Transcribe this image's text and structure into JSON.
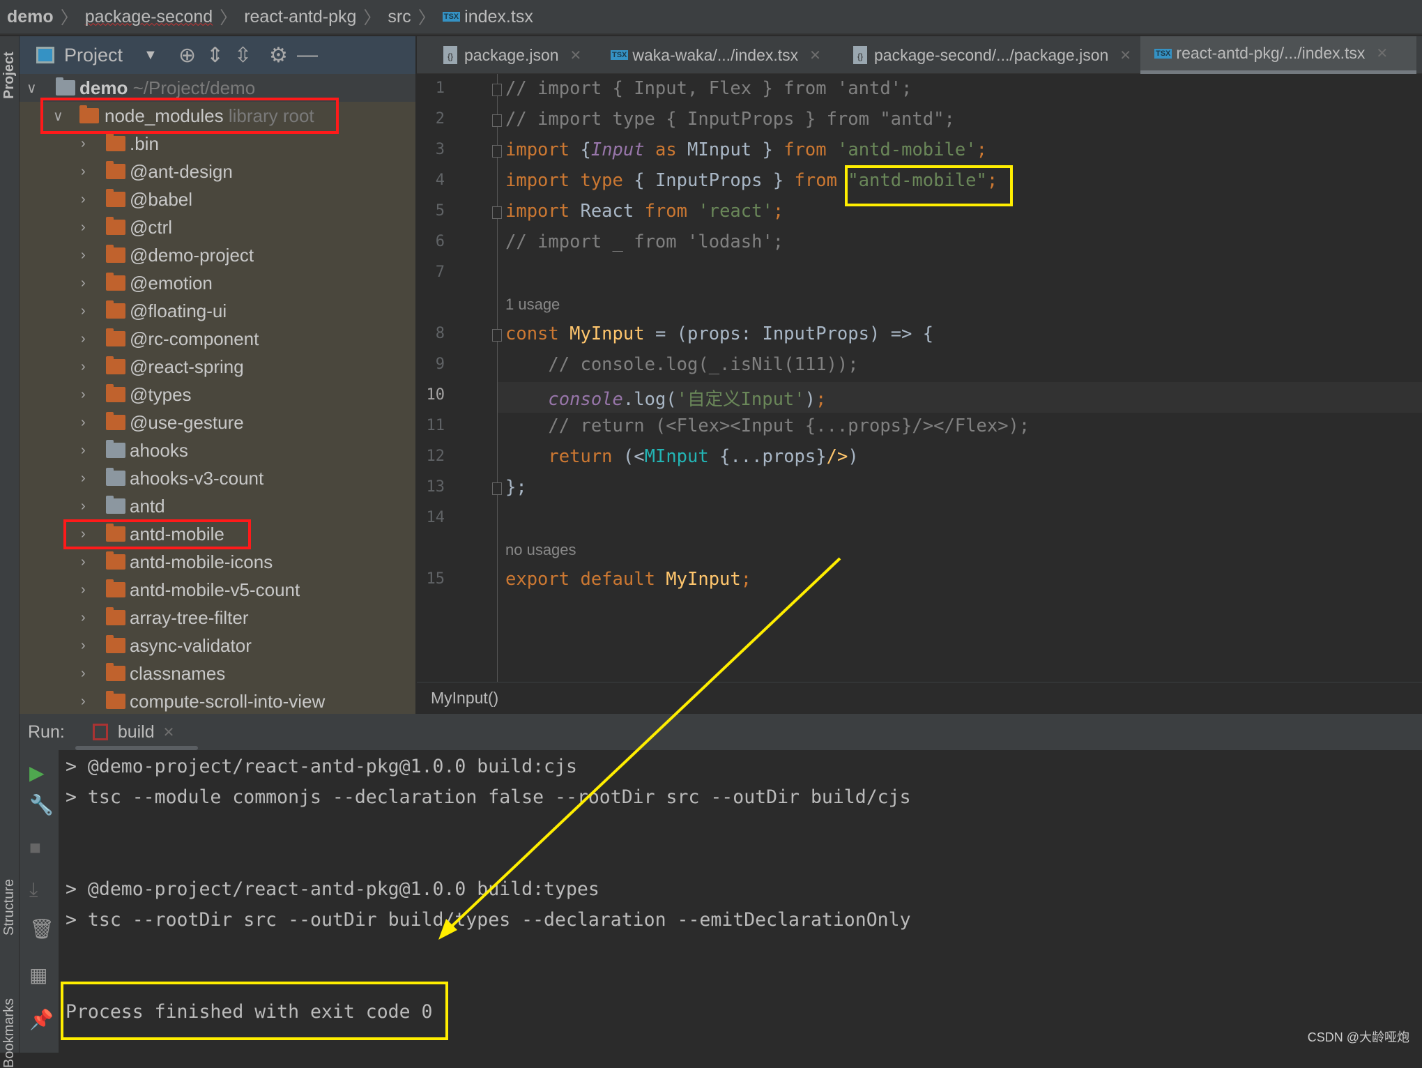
{
  "breadcrumb": [
    "demo",
    "package-second",
    "react-antd-pkg",
    "src",
    "index.tsx"
  ],
  "sidestrip": {
    "project": "Project",
    "structure": "Structure",
    "bookmarks": "Bookmarks"
  },
  "project_panel": {
    "title": "Project",
    "root": {
      "name": "demo",
      "path": "~/Project/demo"
    },
    "node_modules": {
      "name": "node_modules",
      "hint": "library root"
    },
    "folders": [
      ".bin",
      "@ant-design",
      "@babel",
      "@ctrl",
      "@demo-project",
      "@emotion",
      "@floating-ui",
      "@rc-component",
      "@react-spring",
      "@types",
      "@use-gesture",
      "ahooks",
      "ahooks-v3-count",
      "antd",
      "antd-mobile",
      "antd-mobile-icons",
      "antd-mobile-v5-count",
      "array-tree-filter",
      "async-validator",
      "classnames",
      "compute-scroll-into-view"
    ]
  },
  "tabs": [
    {
      "label": "package.json",
      "icon": "json-icon"
    },
    {
      "label": "waka-waka/.../index.tsx",
      "icon": "tsx-icon"
    },
    {
      "label": "package-second/.../package.json",
      "icon": "json-icon"
    },
    {
      "label": "react-antd-pkg/.../index.tsx",
      "icon": "tsx-icon",
      "active": true
    }
  ],
  "editor": {
    "inlay_1usage": "1 usage",
    "inlay_nousages": "no usages",
    "current_line": 10,
    "line_numbers": [
      "1",
      "2",
      "3",
      "4",
      "5",
      "6",
      "7",
      "8",
      "9",
      "10",
      "11",
      "12",
      "13",
      "14",
      "15"
    ],
    "lines": {
      "l1": "// import { Input, Flex } from 'antd';",
      "l2": "// import type { InputProps } from \"antd\";",
      "l3": [
        "import",
        " {",
        "Input",
        " as ",
        "MInput",
        " } ",
        "from",
        " 'antd-mobile'",
        ";"
      ],
      "l4": [
        "import type",
        " { InputProps } ",
        "from",
        " \"antd-mobile\"",
        ";"
      ],
      "l5": [
        "import",
        " React ",
        "from",
        " 'react'",
        ";"
      ],
      "l6": "// import _ from 'lodash';",
      "l8": [
        "const ",
        "MyInput",
        " = (props: InputProps) => {"
      ],
      "l9": "    // console.log(_.isNil(111));",
      "l10": [
        "    ",
        "console",
        ".log(",
        "'自定义Input'",
        ")",
        ";"
      ],
      "l11": "    // return (<Flex><Input {...props}/></Flex>);",
      "l12": [
        "    ",
        "return",
        " (<",
        "MInput",
        " {...props}",
        "/>",
        ")"
      ],
      "l13": "};",
      "l15": [
        "export default ",
        "MyInput",
        ";"
      ]
    },
    "breadcrumb": "MyInput()"
  },
  "run": {
    "label": "Run:",
    "tab": "build",
    "console": [
      "> @demo-project/react-antd-pkg@1.0.0 build:cjs",
      "> tsc --module commonjs --declaration false --rootDir src --outDir build/cjs",
      "> @demo-project/react-antd-pkg@1.0.0 build:types",
      "> tsc --rootDir src --outDir build/types --declaration --emitDeclarationOnly",
      "Process finished with exit code 0"
    ]
  },
  "watermark": "CSDN @大龄哑炮",
  "colors": {
    "annotation_red": "#ff1a1a",
    "annotation_yellow": "#ffee00",
    "keyword": "#cc7832",
    "string": "#6a8759"
  }
}
